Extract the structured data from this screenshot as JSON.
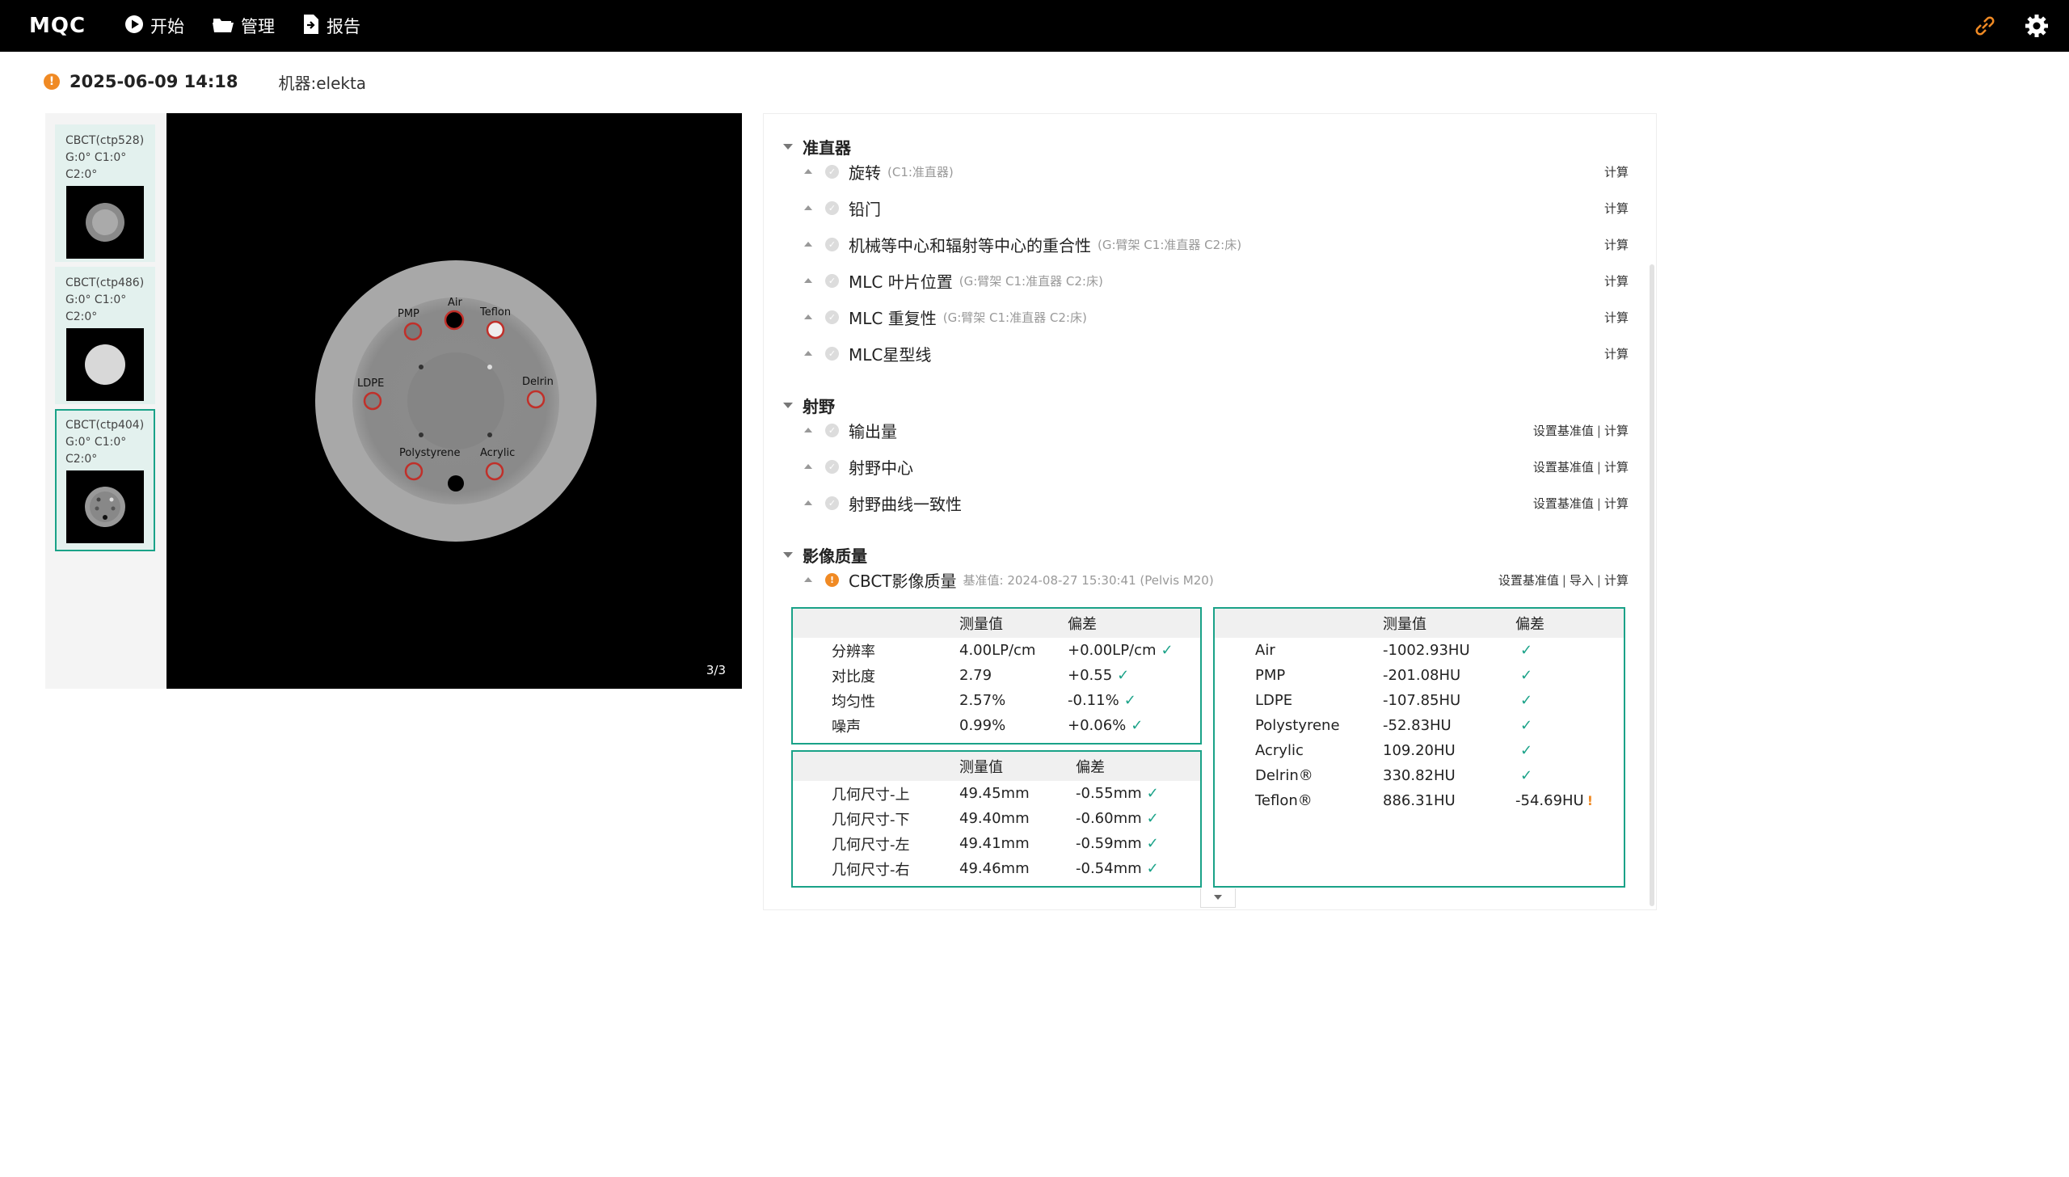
{
  "app": {
    "brand": "MQC",
    "nav": [
      {
        "label": "开始",
        "icon": "play-icon"
      },
      {
        "label": "管理",
        "icon": "folder-icon"
      },
      {
        "label": "报告",
        "icon": "export-icon"
      }
    ],
    "right_icons": [
      "link-icon",
      "gear-icon"
    ],
    "accent_color": "#1aa288",
    "warn_color": "#f08a24"
  },
  "info": {
    "datetime": "2025-06-09 14:18",
    "machine": "机器:elekta"
  },
  "thumbnails": [
    {
      "lines": [
        "CBCT(ctp528)",
        "G:0° C1:0°",
        "C2:0°"
      ],
      "active": false
    },
    {
      "lines": [
        "CBCT(ctp486)",
        "G:0° C1:0°",
        "C2:0°"
      ],
      "active": false
    },
    {
      "lines": [
        "CBCT(ctp404)",
        "G:0° C1:0°",
        "C2:0°"
      ],
      "active": true
    }
  ],
  "viewer": {
    "page_indicator": "3/3",
    "labels": [
      "PMP",
      "Air",
      "Teflon",
      "LDPE",
      "Delrin",
      "Polystyrene",
      "Acrylic"
    ]
  },
  "sections": [
    {
      "title": "准直器",
      "items": [
        {
          "name": "旋转",
          "sub": "(C1:准直器)",
          "actions": [
            "计算"
          ]
        },
        {
          "name": "铅门",
          "sub": "",
          "actions": [
            "计算"
          ]
        },
        {
          "name": "机械等中心和辐射等中心的重合性",
          "sub": "(G:臂架 C1:准直器 C2:床)",
          "actions": [
            "计算"
          ]
        },
        {
          "name": "MLC 叶片位置",
          "sub": "(G:臂架 C1:准直器 C2:床)",
          "actions": [
            "计算"
          ]
        },
        {
          "name": "MLC 重复性",
          "sub": "(G:臂架 C1:准直器 C2:床)",
          "actions": [
            "计算"
          ]
        },
        {
          "name": "MLC星型线",
          "sub": "",
          "actions": [
            "计算"
          ]
        }
      ]
    },
    {
      "title": "射野",
      "items": [
        {
          "name": "输出量",
          "sub": "",
          "actions": [
            "设置基准值",
            "计算"
          ]
        },
        {
          "name": "射野中心",
          "sub": "",
          "actions": [
            "设置基准值",
            "计算"
          ]
        },
        {
          "name": "射野曲线一致性",
          "sub": "",
          "actions": [
            "设置基准值",
            "计算"
          ]
        }
      ]
    },
    {
      "title": "影像质量",
      "items": [
        {
          "name": "CBCT影像质量",
          "sub": "基准值: 2024-08-27 15:30:41 (Pelvis M20)",
          "actions": [
            "设置基准值",
            "导入",
            "计算"
          ],
          "warn": true
        }
      ]
    }
  ],
  "tables": {
    "headers": {
      "measured": "测量值",
      "deviation": "偏差"
    },
    "image_quality": [
      {
        "name": "分辨率",
        "value": "4.00LP/cm",
        "dev": "+0.00LP/cm",
        "status": "ok"
      },
      {
        "name": "对比度",
        "value": "2.79",
        "dev": "+0.55",
        "status": "ok"
      },
      {
        "name": "均匀性",
        "value": "2.57%",
        "dev": "-0.11%",
        "status": "ok"
      },
      {
        "name": "噪声",
        "value": "0.99%",
        "dev": "+0.06%",
        "status": "ok"
      }
    ],
    "geometry": [
      {
        "name": "几何尺寸-上",
        "value": "49.45mm",
        "dev": "-0.55mm",
        "status": "ok"
      },
      {
        "name": "几何尺寸-下",
        "value": "49.40mm",
        "dev": "-0.60mm",
        "status": "ok"
      },
      {
        "name": "几何尺寸-左",
        "value": "49.41mm",
        "dev": "-0.59mm",
        "status": "ok"
      },
      {
        "name": "几何尺寸-右",
        "value": "49.46mm",
        "dev": "-0.54mm",
        "status": "ok"
      }
    ],
    "hu": [
      {
        "name": "Air",
        "value": "-1002.93HU",
        "dev": "",
        "status": "ok"
      },
      {
        "name": "PMP",
        "value": "-201.08HU",
        "dev": "",
        "status": "ok"
      },
      {
        "name": "LDPE",
        "value": "-107.85HU",
        "dev": "",
        "status": "ok"
      },
      {
        "name": "Polystyrene",
        "value": "-52.83HU",
        "dev": "",
        "status": "ok"
      },
      {
        "name": "Acrylic",
        "value": "109.20HU",
        "dev": "",
        "status": "ok"
      },
      {
        "name": "Delrin®",
        "value": "330.82HU",
        "dev": "",
        "status": "ok"
      },
      {
        "name": "Teflon®",
        "value": "886.31HU",
        "dev": "-54.69HU",
        "status": "warn"
      }
    ]
  }
}
